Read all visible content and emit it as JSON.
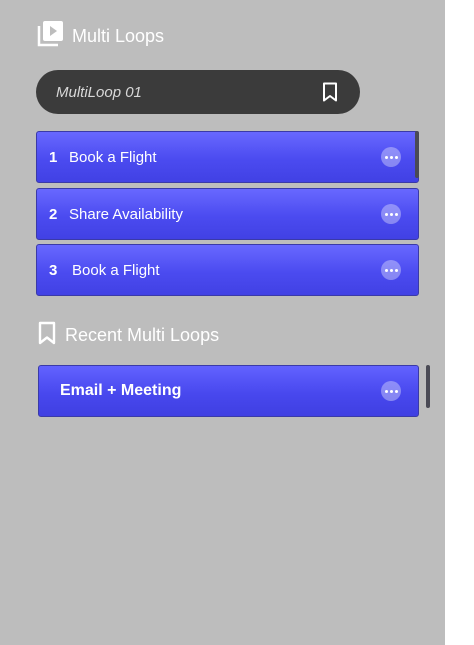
{
  "multi_loops": {
    "header": {
      "icon": "play-library-icon",
      "title": "Multi Loops"
    },
    "current": {
      "name": "MultiLoop 01",
      "bookmark_icon": "bookmark-icon"
    },
    "items": [
      {
        "number": "1",
        "title": "Book a Flight"
      },
      {
        "number": "2",
        "title": "Share Availability"
      },
      {
        "number": "3",
        "title": "Book a Flight"
      }
    ]
  },
  "recent": {
    "header": {
      "icon": "bookmark-icon",
      "title": "Recent Multi Loops"
    },
    "items": [
      {
        "title": "Email + Meeting"
      }
    ]
  },
  "colors": {
    "panel_bg": "#bdbdbd",
    "pill_bg": "#3b3b3b",
    "card_accent": "#4b4bf0"
  }
}
